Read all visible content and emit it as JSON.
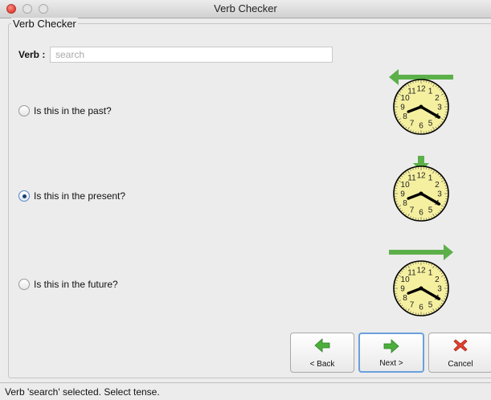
{
  "window": {
    "title": "Verb Checker"
  },
  "group": {
    "title": "Verb Checker"
  },
  "verb": {
    "label": "Verb :",
    "value": "",
    "placeholder": "search"
  },
  "options": [
    {
      "label": "Is this in the past?",
      "checked": false,
      "arrow": "left-arrow"
    },
    {
      "label": "Is this in the present?",
      "checked": true,
      "arrow": "down-arrow"
    },
    {
      "label": "Is this in the future?",
      "checked": false,
      "arrow": "right-arrow"
    }
  ],
  "clock": {
    "numerals": [
      "12",
      "1",
      "2",
      "3",
      "4",
      "5",
      "6",
      "7",
      "8",
      "9",
      "10",
      "11"
    ],
    "face_color": "#f5f0a0",
    "hand_color": "#000000",
    "arrow_color": "#5cb04a"
  },
  "buttons": {
    "back": {
      "label": "< Back",
      "icon": "green-left-arrow-icon"
    },
    "next": {
      "label": "Next >",
      "icon": "green-right-arrow-icon"
    },
    "cancel": {
      "label": "Cancel",
      "icon": "red-x-icon"
    }
  },
  "status": {
    "text": "Verb 'search' selected.  Select tense."
  }
}
